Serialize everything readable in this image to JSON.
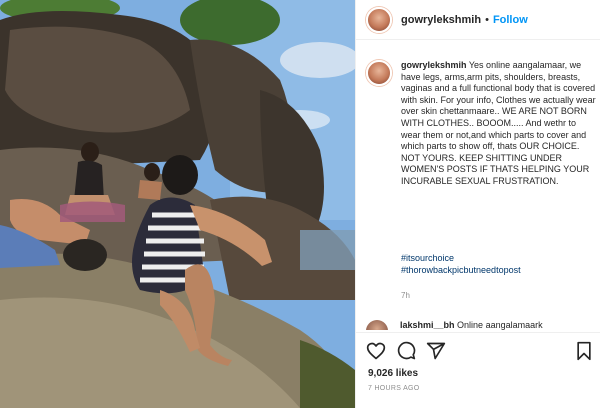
{
  "post": {
    "username": "gowrylekshmih",
    "follow_dot": "•",
    "follow_label": "Follow",
    "caption_user": "gowrylekshmih",
    "caption_body": "Yes online aangalamaar, we have legs, arms,arm pits, shoulders, breasts, vaginas and a full functional body that is covered with skin. For your info, Clothes we actually wear over skin chettanmaare.. WE ARE NOT BORN WITH CLOTHES.. BOOOM..... And wethr to wear them or not,and which parts to cover and which parts to show off, thats OUR CHOICE. NOT YOURS. KEEP SHITTING UNDER WOMEN'S POSTS IF THATS HELPING YOUR INCURABLE SEXUAL FRUSTRATION.",
    "hashtags": [
      "#itsourchoice",
      "#thorowbackpicbutneedtopost"
    ],
    "caption_time": "7h",
    "comment_user": "lakshmi__bh",
    "comment_text": "Online aangalamaark",
    "likes": "9,026 likes",
    "time_ago": "7 HOURS AGO"
  },
  "icons": {
    "like": "heart-icon",
    "comment": "comment-icon",
    "share": "paper-plane-icon",
    "save": "bookmark-icon"
  },
  "colors": {
    "follow": "#0095f6",
    "hashtag": "#00376b",
    "muted": "#8e8e8e",
    "text": "#262626"
  }
}
